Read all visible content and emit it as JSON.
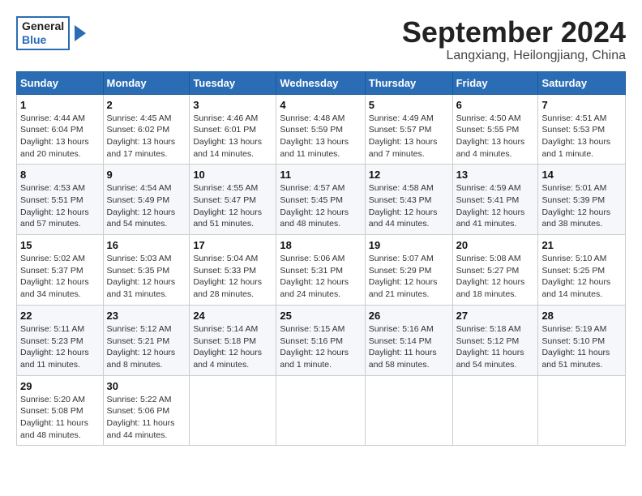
{
  "header": {
    "logo_general": "General",
    "logo_blue": "Blue",
    "month_title": "September 2024",
    "location": "Langxiang, Heilongjiang, China"
  },
  "calendar": {
    "days_of_week": [
      "Sunday",
      "Monday",
      "Tuesday",
      "Wednesday",
      "Thursday",
      "Friday",
      "Saturday"
    ],
    "weeks": [
      [
        {
          "day": "1",
          "info": "Sunrise: 4:44 AM\nSunset: 6:04 PM\nDaylight: 13 hours\nand 20 minutes."
        },
        {
          "day": "2",
          "info": "Sunrise: 4:45 AM\nSunset: 6:02 PM\nDaylight: 13 hours\nand 17 minutes."
        },
        {
          "day": "3",
          "info": "Sunrise: 4:46 AM\nSunset: 6:01 PM\nDaylight: 13 hours\nand 14 minutes."
        },
        {
          "day": "4",
          "info": "Sunrise: 4:48 AM\nSunset: 5:59 PM\nDaylight: 13 hours\nand 11 minutes."
        },
        {
          "day": "5",
          "info": "Sunrise: 4:49 AM\nSunset: 5:57 PM\nDaylight: 13 hours\nand 7 minutes."
        },
        {
          "day": "6",
          "info": "Sunrise: 4:50 AM\nSunset: 5:55 PM\nDaylight: 13 hours\nand 4 minutes."
        },
        {
          "day": "7",
          "info": "Sunrise: 4:51 AM\nSunset: 5:53 PM\nDaylight: 13 hours\nand 1 minute."
        }
      ],
      [
        {
          "day": "8",
          "info": "Sunrise: 4:53 AM\nSunset: 5:51 PM\nDaylight: 12 hours\nand 57 minutes."
        },
        {
          "day": "9",
          "info": "Sunrise: 4:54 AM\nSunset: 5:49 PM\nDaylight: 12 hours\nand 54 minutes."
        },
        {
          "day": "10",
          "info": "Sunrise: 4:55 AM\nSunset: 5:47 PM\nDaylight: 12 hours\nand 51 minutes."
        },
        {
          "day": "11",
          "info": "Sunrise: 4:57 AM\nSunset: 5:45 PM\nDaylight: 12 hours\nand 48 minutes."
        },
        {
          "day": "12",
          "info": "Sunrise: 4:58 AM\nSunset: 5:43 PM\nDaylight: 12 hours\nand 44 minutes."
        },
        {
          "day": "13",
          "info": "Sunrise: 4:59 AM\nSunset: 5:41 PM\nDaylight: 12 hours\nand 41 minutes."
        },
        {
          "day": "14",
          "info": "Sunrise: 5:01 AM\nSunset: 5:39 PM\nDaylight: 12 hours\nand 38 minutes."
        }
      ],
      [
        {
          "day": "15",
          "info": "Sunrise: 5:02 AM\nSunset: 5:37 PM\nDaylight: 12 hours\nand 34 minutes."
        },
        {
          "day": "16",
          "info": "Sunrise: 5:03 AM\nSunset: 5:35 PM\nDaylight: 12 hours\nand 31 minutes."
        },
        {
          "day": "17",
          "info": "Sunrise: 5:04 AM\nSunset: 5:33 PM\nDaylight: 12 hours\nand 28 minutes."
        },
        {
          "day": "18",
          "info": "Sunrise: 5:06 AM\nSunset: 5:31 PM\nDaylight: 12 hours\nand 24 minutes."
        },
        {
          "day": "19",
          "info": "Sunrise: 5:07 AM\nSunset: 5:29 PM\nDaylight: 12 hours\nand 21 minutes."
        },
        {
          "day": "20",
          "info": "Sunrise: 5:08 AM\nSunset: 5:27 PM\nDaylight: 12 hours\nand 18 minutes."
        },
        {
          "day": "21",
          "info": "Sunrise: 5:10 AM\nSunset: 5:25 PM\nDaylight: 12 hours\nand 14 minutes."
        }
      ],
      [
        {
          "day": "22",
          "info": "Sunrise: 5:11 AM\nSunset: 5:23 PM\nDaylight: 12 hours\nand 11 minutes."
        },
        {
          "day": "23",
          "info": "Sunrise: 5:12 AM\nSunset: 5:21 PM\nDaylight: 12 hours\nand 8 minutes."
        },
        {
          "day": "24",
          "info": "Sunrise: 5:14 AM\nSunset: 5:18 PM\nDaylight: 12 hours\nand 4 minutes."
        },
        {
          "day": "25",
          "info": "Sunrise: 5:15 AM\nSunset: 5:16 PM\nDaylight: 12 hours\nand 1 minute."
        },
        {
          "day": "26",
          "info": "Sunrise: 5:16 AM\nSunset: 5:14 PM\nDaylight: 11 hours\nand 58 minutes."
        },
        {
          "day": "27",
          "info": "Sunrise: 5:18 AM\nSunset: 5:12 PM\nDaylight: 11 hours\nand 54 minutes."
        },
        {
          "day": "28",
          "info": "Sunrise: 5:19 AM\nSunset: 5:10 PM\nDaylight: 11 hours\nand 51 minutes."
        }
      ],
      [
        {
          "day": "29",
          "info": "Sunrise: 5:20 AM\nSunset: 5:08 PM\nDaylight: 11 hours\nand 48 minutes."
        },
        {
          "day": "30",
          "info": "Sunrise: 5:22 AM\nSunset: 5:06 PM\nDaylight: 11 hours\nand 44 minutes."
        },
        {
          "day": "",
          "info": ""
        },
        {
          "day": "",
          "info": ""
        },
        {
          "day": "",
          "info": ""
        },
        {
          "day": "",
          "info": ""
        },
        {
          "day": "",
          "info": ""
        }
      ]
    ]
  }
}
